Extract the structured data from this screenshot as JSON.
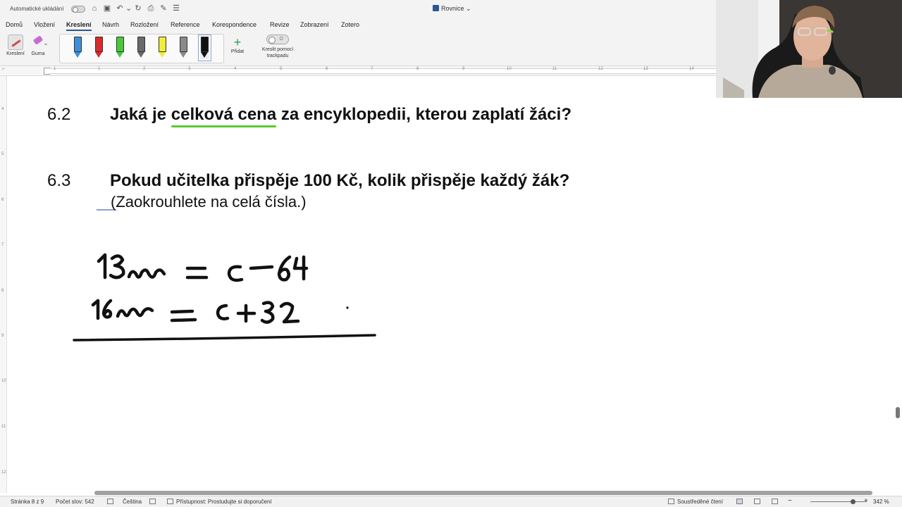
{
  "titlebar": {
    "autosave_label": "Automatické ukládání",
    "doc_title": "Rovnice",
    "chevron": "⌄"
  },
  "tabs": [
    "Domů",
    "Vložení",
    "Kreslení",
    "Návrh",
    "Rozložení",
    "Reference",
    "Korespondence",
    "Revize",
    "Zobrazení",
    "Zotero"
  ],
  "active_tab": "Kreslení",
  "ribbon": {
    "draw_label": "Kreslení",
    "eraser_label": "Guma",
    "add_label": "Přidat",
    "trackpad_label": "Kreslit pomocí trackpadu",
    "trackpad_toggle_text": "O",
    "pen_colors": [
      "#3c8fd9",
      "#d92b2b",
      "#49c93a",
      "#6a6a6a",
      "#f2ec3a",
      "#8a8a8a",
      "#111111"
    ]
  },
  "ruler": {
    "h_numbers": [
      "1",
      "1",
      "2",
      "3",
      "4",
      "5",
      "6",
      "7",
      "8",
      "9",
      "10",
      "11",
      "12",
      "13",
      "14"
    ],
    "v_numbers": [
      "4",
      "5",
      "6",
      "7",
      "8",
      "9",
      "10",
      "11",
      "12"
    ]
  },
  "document": {
    "q62_num": "6.2",
    "q62_before": "Jaká je ",
    "q62_highlight": "celková cena",
    "q62_after": " za encyklopedii, kterou zaplatí žáci?",
    "q63_num": "6.3",
    "q63_text": "Pokud učitelka přispěje 100 Kč, kolik přispěje každý žák?",
    "q63_sub": "(Zaokrouhlete na celá čísla.)"
  },
  "status": {
    "page": "Stránka 8 z 9",
    "words": "Počet slov: 542",
    "language": "Čeština",
    "accessibility": "Přístupnost: Prostudujte si doporučení",
    "focus": "Soustředěné čtení",
    "zoom": "342 %"
  },
  "colors": {
    "accent": "#2b5797",
    "highlight_green": "#58cc2f"
  }
}
